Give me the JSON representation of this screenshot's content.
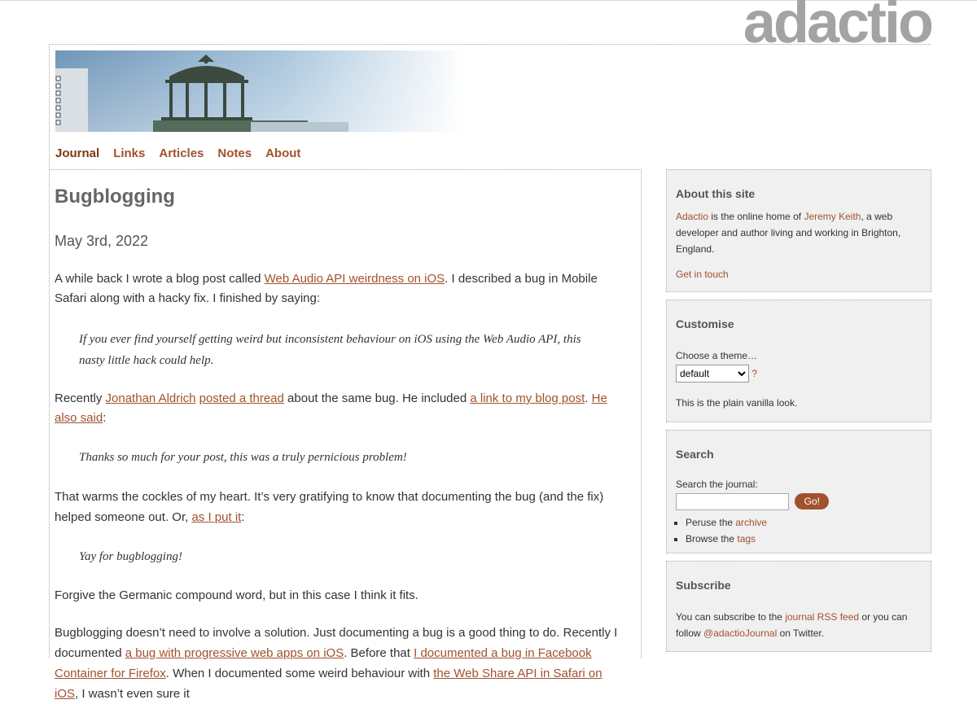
{
  "site": {
    "logo": "adactio"
  },
  "nav": {
    "items": [
      "Journal",
      "Links",
      "Articles",
      "Notes",
      "About"
    ]
  },
  "article": {
    "title": "Bugblogging",
    "date": "May 3rd, 2022",
    "p1_a": "A while back I wrote a blog post called ",
    "p1_link": "Web Audio API weirdness on iOS",
    "p1_b": ". I described a bug in Mobile Safari along with a hacky fix. I finished by saying:",
    "quote1": "If you ever find yourself getting weird but inconsistent behaviour on iOS using the Web Audio API, this nasty little hack could help.",
    "p2_a": "Recently ",
    "p2_link1": "Jonathan Aldrich",
    "p2_link2": "posted a thread",
    "p2_b": " about the same bug. He included ",
    "p2_link3": "a link to my blog post",
    "p2_c": ". ",
    "p2_link4": "He also said",
    "p2_d": ":",
    "quote2": "Thanks so much for your post, this was a truly pernicious problem!",
    "p3_a": "That warms the cockles of my heart. It’s very gratifying to know that documenting the bug (and the fix) helped someone out. Or, ",
    "p3_link": "as I put it",
    "p3_b": ":",
    "quote3": "Yay for bugblogging!",
    "p4": "Forgive the Germanic compound word, but in this case I think it fits.",
    "p5_a": "Bugblogging doesn’t need to involve a solution. Just documenting a bug is a good thing to do. Recently I documented ",
    "p5_link1": "a bug with progressive web apps on iOS",
    "p5_b": ". Before that ",
    "p5_link2": "I documented a bug in Facebook Container for Firefox",
    "p5_c": ". When I documented some weird behaviour with ",
    "p5_link3": "the Web Share API in Safari on iOS",
    "p5_d": ", I wasn’t even sure it"
  },
  "sidebar": {
    "about": {
      "title": "About this site",
      "link1": "Adactio",
      "t1": " is the online home of ",
      "link2": "Jeremy Keith",
      "t2": ", a web developer and author living and working in Brighton, England.",
      "contact": "Get in touch"
    },
    "customise": {
      "title": "Customise",
      "label": "Choose a theme…",
      "selected": "default",
      "help": "?",
      "desc": "This is the plain vanilla look."
    },
    "search": {
      "title": "Search",
      "label": "Search the journal:",
      "button": "Go!",
      "item1_a": "Peruse the ",
      "item1_link": "archive",
      "item2_a": "Browse the ",
      "item2_link": "tags"
    },
    "subscribe": {
      "title": "Subscribe",
      "t1": "You can subscribe to the ",
      "link1": "journal RSS feed",
      "t2": " or you can follow ",
      "link2": "@adactioJournal",
      "t3": " on Twitter."
    }
  }
}
